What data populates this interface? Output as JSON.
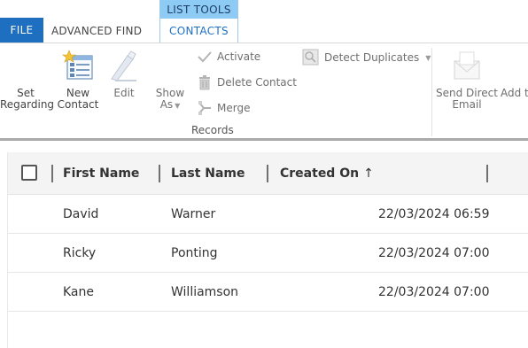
{
  "tabs": {
    "file": "FILE",
    "advanced_find": "ADVANCED FIND",
    "context_group": "LIST TOOLS",
    "contacts": "CONTACTS"
  },
  "ribbon": {
    "set_regarding": [
      "Set",
      "Regarding"
    ],
    "new_contact": [
      "New",
      "Contact"
    ],
    "edit": "Edit",
    "show_as": [
      "Show",
      "As"
    ],
    "activate": "Activate",
    "delete_contact": "Delete Contact",
    "merge": "Merge",
    "detect_duplicates": "Detect Duplicates",
    "group_records": "Records",
    "send_direct_email": [
      "Send Direct",
      "Email"
    ],
    "add_to": "Add t"
  },
  "grid": {
    "columns": [
      "First Name",
      "Last Name",
      "Created On"
    ],
    "sort_indicator": "↑",
    "rows": [
      {
        "first": "David",
        "last": "Warner",
        "created": "22/03/2024 06:59"
      },
      {
        "first": "Ricky",
        "last": "Ponting",
        "created": "22/03/2024 07:00"
      },
      {
        "first": "Kane",
        "last": "Williamson",
        "created": "22/03/2024 07:00"
      }
    ]
  },
  "colors": {
    "file_tab": "#1f6fc0",
    "context_header": "#8ecbf4",
    "contacts_tab_text": "#1f6fc0"
  }
}
